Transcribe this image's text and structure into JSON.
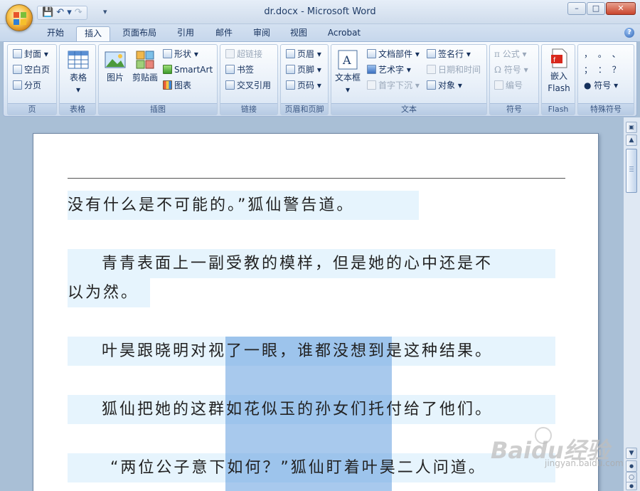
{
  "window": {
    "title": "dr.docx - Microsoft Word",
    "minimize": "–",
    "restore": "□",
    "close": "✕"
  },
  "qat": {
    "save": "💾",
    "undo": "↶ ▾",
    "redo": "↷",
    "more": "▾"
  },
  "tabs": [
    "开始",
    "插入",
    "页面布局",
    "引用",
    "邮件",
    "审阅",
    "视图",
    "Acrobat"
  ],
  "active_tab": "插入",
  "help": "?",
  "ribbon": {
    "page": {
      "label": "页",
      "cover": "封面",
      "blank": "空白页",
      "break": "分页"
    },
    "table": {
      "label": "表格",
      "button": "表格"
    },
    "illustrations": {
      "label": "插图",
      "picture": "图片",
      "clipart": "剪贴画",
      "shapes": "形状",
      "smartart": "SmartArt",
      "chart": "图表"
    },
    "links": {
      "label": "链接",
      "hyperlink": "超链接",
      "bookmark": "书签",
      "crossref": "交叉引用"
    },
    "header_footer": {
      "label": "页眉和页脚",
      "header": "页眉",
      "footer": "页脚",
      "page_number": "页码"
    },
    "text": {
      "label": "文本",
      "textbox": "文本框",
      "quickparts": "文档部件",
      "wordart": "艺术字",
      "dropcap": "首字下沉",
      "signature": "签名行",
      "datetime": "日期和时间",
      "object": "对象"
    },
    "symbols": {
      "label": "符号",
      "equation": "公式",
      "symbol": "符号",
      "number": "编号"
    },
    "flash": {
      "label": "Flash",
      "embed": "嵌入",
      "embed2": "Flash"
    },
    "special": {
      "label": "特殊符号",
      "row1": "，  。  、",
      "row2": "；  ：  ？",
      "symbol": "符号"
    }
  },
  "document": {
    "paragraphs": [
      "没有什么是不可能的。”狐仙警告道。",
      "青青表面上一副受教的模样，但是她的心中还是不",
      "以为然。",
      "叶昊跟晓明对视了一眼，谁都没想到是这种结果。",
      "狐仙把她的这群如花似玉的孙女们托付给了他们。",
      "“两位公子意下如何？”狐仙盯着叶昊二人问道。"
    ]
  },
  "scrollbar": {
    "up": "▲",
    "down": "▼",
    "prev": "●",
    "browse": "○",
    "next": "●"
  },
  "watermark": {
    "main": "Baidu经验",
    "sub": "jingyan.baidu.com"
  }
}
